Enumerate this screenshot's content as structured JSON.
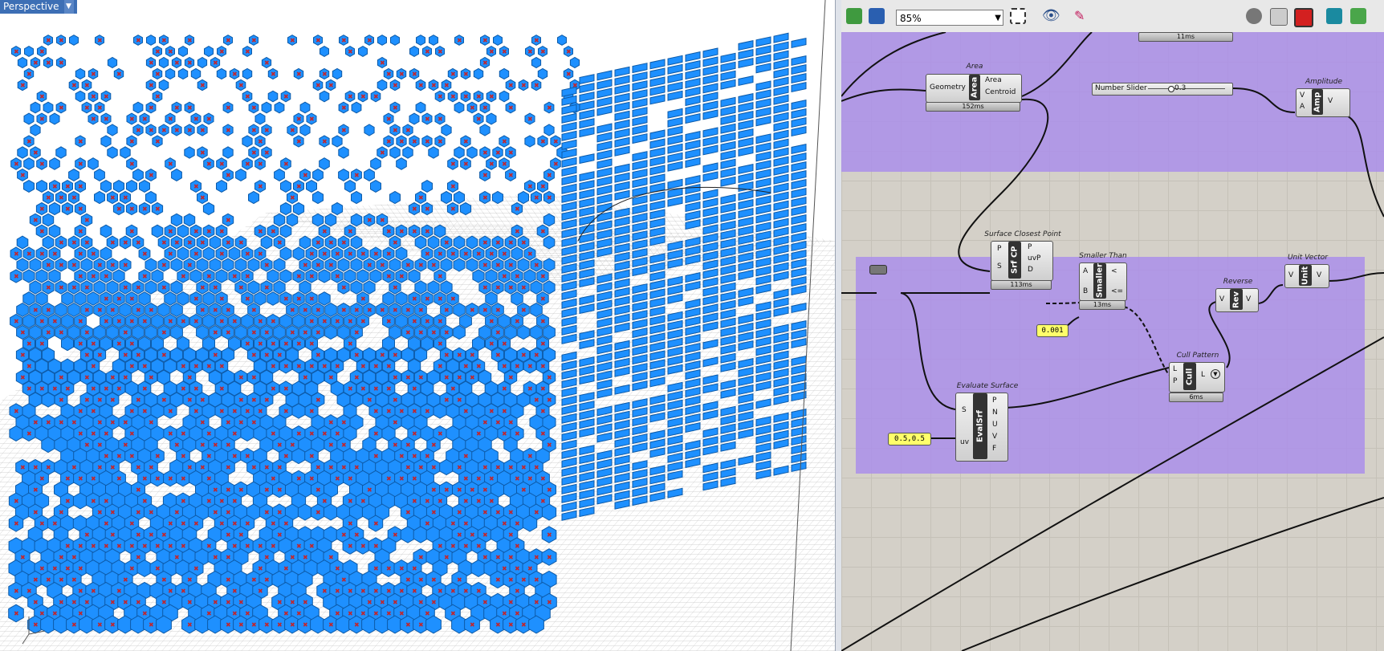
{
  "viewport": {
    "tab_label": "Perspective",
    "colors": {
      "module": "#1e90ff",
      "marker": "#c1272d",
      "grid": "#cfcfcf"
    }
  },
  "grasshopper": {
    "toolbar": {
      "zoom": "85%",
      "icons": [
        "open-file-icon",
        "save-icon",
        "zoom-extents-icon",
        "preview-icon",
        "sketch-icon",
        "shaded-preview-icon",
        "wireframe-preview-icon",
        "selected-preview-icon",
        "bake-icon",
        "display-icon"
      ]
    },
    "group_colors": {
      "group": "#a98ceb"
    },
    "components": {
      "top_timer": "11ms",
      "area": {
        "title": "Area",
        "input": "Geometry",
        "core": "Area",
        "outputs": [
          "Area",
          "Centroid"
        ],
        "time": "152ms"
      },
      "slider": {
        "label": "Number Slider",
        "value": "0.3"
      },
      "amplitude": {
        "title": "Amplitude",
        "inputs": [
          "V",
          "A"
        ],
        "core": "Amp",
        "output": "V"
      },
      "scp": {
        "title": "Surface Closest Point",
        "inputs": [
          "P",
          "S"
        ],
        "core": "Srf CP",
        "outputs": [
          "P",
          "uvP",
          "D"
        ],
        "time": "113ms"
      },
      "smaller": {
        "title": "Smaller Than",
        "inputs": [
          "A",
          "B"
        ],
        "core": "Smaller",
        "outputs": [
          "<",
          "<="
        ],
        "time": "13ms"
      },
      "threshold": "0.001",
      "reverse": {
        "title": "Reverse",
        "input": "V",
        "core": "Rev",
        "output": "V"
      },
      "unit": {
        "title": "Unit Vector",
        "input": "V",
        "core": "Unit",
        "output": "V"
      },
      "cull": {
        "title": "Cull Pattern",
        "inputs": [
          "L",
          "P"
        ],
        "core": "Cull",
        "output": "L",
        "time": "6ms"
      },
      "evalsrf": {
        "title": "Evaluate Surface",
        "inputs": [
          "S",
          "uv"
        ],
        "core": "EvalSrf",
        "outputs": [
          "P",
          "N",
          "U",
          "V",
          "F"
        ]
      },
      "uv_panel": "0.5,0.5"
    }
  }
}
